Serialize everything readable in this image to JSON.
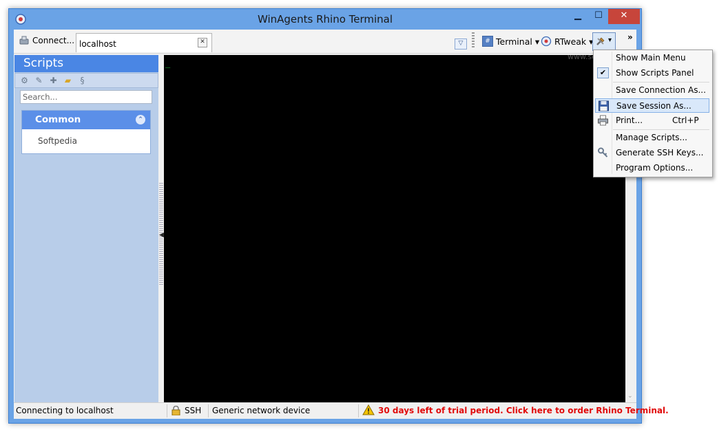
{
  "window": {
    "title": "WinAgents Rhino Terminal",
    "min_glyph": "▁",
    "max_glyph": "☐",
    "close_glyph": "✕"
  },
  "toolbar": {
    "connect_label": "Connect...",
    "tab_label": "localhost",
    "tab_close_glyph": "✕",
    "tab_dropdown_glyph": "▽",
    "terminal_label": "Terminal",
    "rtweak_label": "RTweak",
    "dropdown_glyph": "▾",
    "more_glyph": "»"
  },
  "sidebar": {
    "title": "Scripts",
    "search_placeholder": "Search...",
    "group": {
      "title": "Common",
      "collapse_glyph": "⌃",
      "items": [
        "Softpedia"
      ]
    }
  },
  "terminal": {
    "cursor": "_",
    "background": "#000000",
    "cursor_color": "#1fc93b"
  },
  "status": {
    "connection": "Connecting to localhost",
    "protocol": "SSH",
    "device": "Generic network device",
    "trial": "30 days left of trial period. Click here to order Rhino Terminal.",
    "trial_color": "#e10b0b"
  },
  "menu": {
    "items": [
      {
        "label": "Show Main Menu",
        "shortcut": "",
        "icon": "",
        "checked": false
      },
      {
        "label": "Show Scripts Panel",
        "shortcut": "",
        "icon": "✔",
        "checked": true
      },
      {
        "label": "Save Connection As...",
        "shortcut": "",
        "icon": "",
        "checked": false
      },
      {
        "label": "Save Session As...",
        "shortcut": "",
        "icon": "floppy-icon",
        "checked": false
      },
      {
        "label": "Print...",
        "shortcut": "Ctrl+P",
        "icon": "printer-icon",
        "checked": false
      },
      {
        "label": "Manage Scripts...",
        "shortcut": "",
        "icon": "",
        "checked": false
      },
      {
        "label": "Generate SSH Keys...",
        "shortcut": "",
        "icon": "key-icon",
        "checked": false
      },
      {
        "label": "Program Options...",
        "shortcut": "",
        "icon": "",
        "checked": false
      }
    ]
  },
  "watermark": "www.softpedia.com",
  "accent_color": "#4a86e4"
}
